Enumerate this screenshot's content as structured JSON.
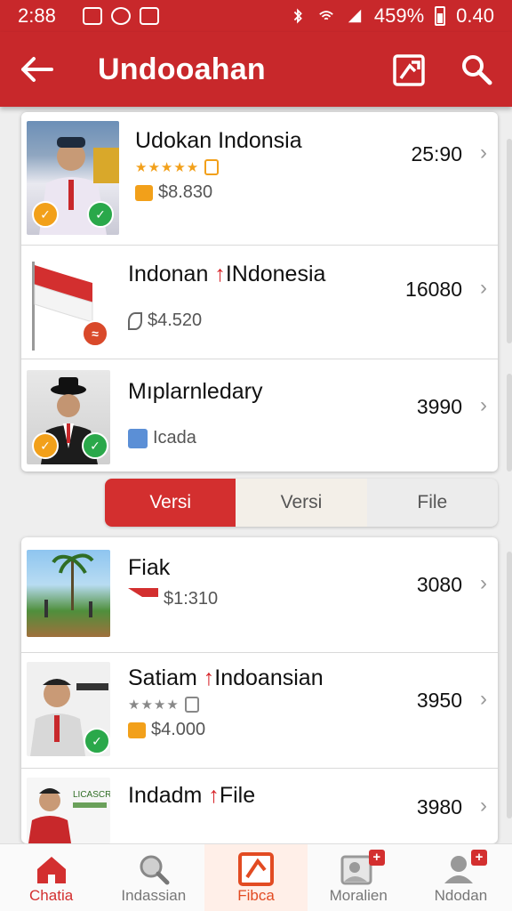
{
  "status_bar": {
    "time": "2:88",
    "battery": "459%",
    "extra": "0.40"
  },
  "app_bar": {
    "title": "Undooahan"
  },
  "top_list": [
    {
      "name": "Udokan Indonsia",
      "rating_text": "★★★★★",
      "sub": "$8.830",
      "value": "25:90"
    },
    {
      "name_a": "Indonan",
      "name_b": "INdonesia",
      "sub": "$4.520",
      "value": "16080"
    },
    {
      "name": "Mıplarnledary",
      "sub": "Icada",
      "value": "3990"
    }
  ],
  "segmented": {
    "tab1": "Versi",
    "tab2": "Versi",
    "tab3": "File"
  },
  "bottom_list": [
    {
      "name": "Fiak",
      "sub": "$1:310",
      "value": "3080"
    },
    {
      "name_a": "Satiam",
      "name_b": "Indoansian",
      "rating_text": "★★★★",
      "sub": "$4.000",
      "value": "3950"
    },
    {
      "name_a": "Indadm",
      "name_b": "File",
      "value": "3980"
    }
  ],
  "thumbs": {
    "banner_text": "LICASCRI"
  },
  "bottom_nav": [
    {
      "label": "Chatia"
    },
    {
      "label": "Indassian"
    },
    {
      "label": "Fibca"
    },
    {
      "label": "Moralien"
    },
    {
      "label": "Ndodan"
    }
  ],
  "colors": {
    "primary": "#c8282b",
    "accent": "#d32f2f",
    "check": "#2aa84a",
    "gold": "#f2a01a"
  }
}
